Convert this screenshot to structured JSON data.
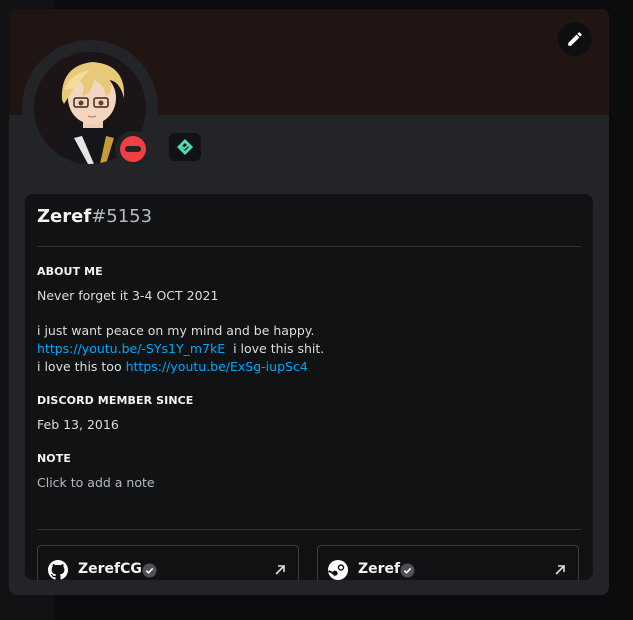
{
  "profile": {
    "username": "Zeref",
    "discriminator": "#5153",
    "status": "do-not-disturb",
    "badge": "nitro-badge-icon"
  },
  "about": {
    "title": "ABOUT ME",
    "line1": "Never forget it 3-4 OCT 2021",
    "line2": "i just want peace on my mind and be happy.",
    "link1": "https://youtu.be/-SYs1Y_m7kE",
    "after_link1": "i love this shit.",
    "before_link2": "i love this too",
    "link2": "https://youtu.be/ExSg-iupSc4"
  },
  "member_since": {
    "title": "DISCORD MEMBER SINCE",
    "date": "Feb 13, 2016"
  },
  "note": {
    "title": "NOTE",
    "placeholder": "Click to add a note"
  },
  "connections": [
    {
      "service": "github",
      "icon": "github-icon",
      "name": "ZerefCG"
    },
    {
      "service": "steam",
      "icon": "steam-icon",
      "name": "Zeref"
    }
  ],
  "colors": {
    "accent_link": "#00a8fc",
    "status_dnd": "#f23f43",
    "banner": "#211514",
    "badge": "#4fdcb6"
  }
}
